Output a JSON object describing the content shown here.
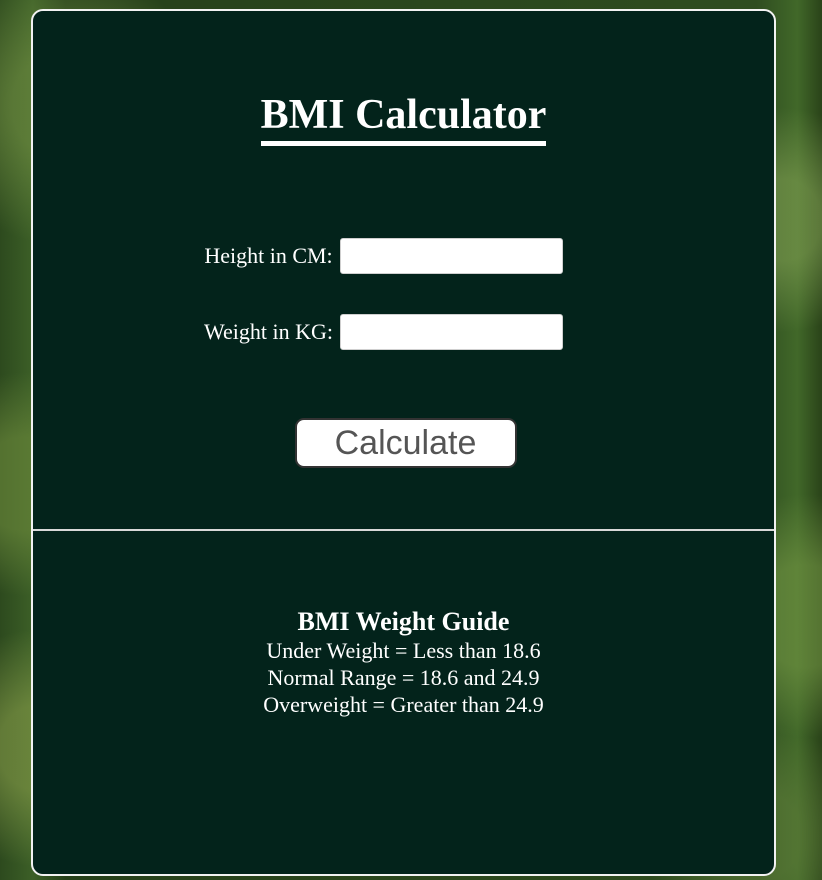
{
  "title": "BMI Calculator",
  "form": {
    "height_label": "Height in CM:",
    "height_value": "",
    "weight_label": "Weight in KG:",
    "weight_value": "",
    "calculate_label": "Calculate"
  },
  "guide": {
    "title": "BMI Weight Guide",
    "lines": [
      "Under Weight = Less than 18.6",
      "Normal Range = 18.6 and 24.9",
      "Overweight = Greater than 24.9"
    ]
  }
}
